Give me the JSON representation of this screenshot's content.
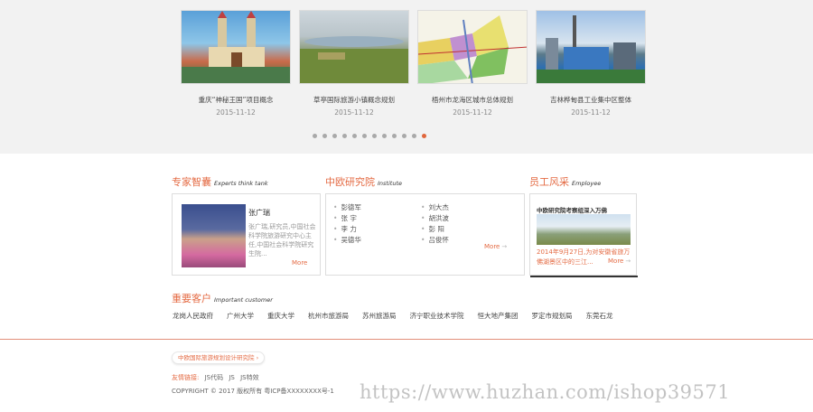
{
  "carousel": {
    "items": [
      {
        "caption": "重庆“神秘王国”项目概念",
        "date": "2015-11-12"
      },
      {
        "caption": "草亭国际旅游小镇概念规划",
        "date": "2015-11-12"
      },
      {
        "caption": "梧州市龙海区城市总体规划",
        "date": "2015-11-12"
      },
      {
        "caption": "吉林桦甸县工业集中区整体",
        "date": "2015-11-12"
      }
    ],
    "dot_count": 12,
    "active_dot": 12,
    "active_color": "#e0663c"
  },
  "experts": {
    "title": "专家智囊",
    "subtitle": "Experts think tank",
    "name": "张广瑞",
    "bio": "张广瑞,研究员,中国社会科学院旅游研究中心主任,中国社会科学院研究生院...",
    "more": "More"
  },
  "institute": {
    "title": "中欧研究院",
    "subtitle": "Institute",
    "col1": [
      "彭德军",
      "张 宇",
      "李 力",
      "吴德华"
    ],
    "col2": [
      "刘大杰",
      "胡洪波",
      "彭 阳",
      "吕俊怀"
    ],
    "more": "More"
  },
  "employee": {
    "title": "员工风采",
    "subtitle": "Employee",
    "news_title": "中欧研究院考察组深入万佛",
    "news_text": "2014年9月27日,为对安徽省旅万佛湖景区中的三江...",
    "more": "More"
  },
  "clients": {
    "title": "重要客户",
    "subtitle": "Important customer",
    "items": [
      "龙岗人民政府",
      "广州大学",
      "重庆大学",
      "杭州市旅游局",
      "苏州旅游局",
      "济宁职业技术学院",
      "恒大地产集团",
      "罗定市规划局",
      "东莞石龙"
    ]
  },
  "footer": {
    "badge": "中欧国际旅游规划设计研究院",
    "links_label": "友情链接:",
    "links": [
      "JS代码",
      "JS",
      "JS特效"
    ],
    "copyright": "COPYRIGHT © 2017 版权所有 粤ICP备XXXXXXXX号-1"
  },
  "watermark": "https://www.huzhan.com/ishop39571",
  "colors": {
    "accent": "#e46b44",
    "band": "#f2f2f2"
  }
}
